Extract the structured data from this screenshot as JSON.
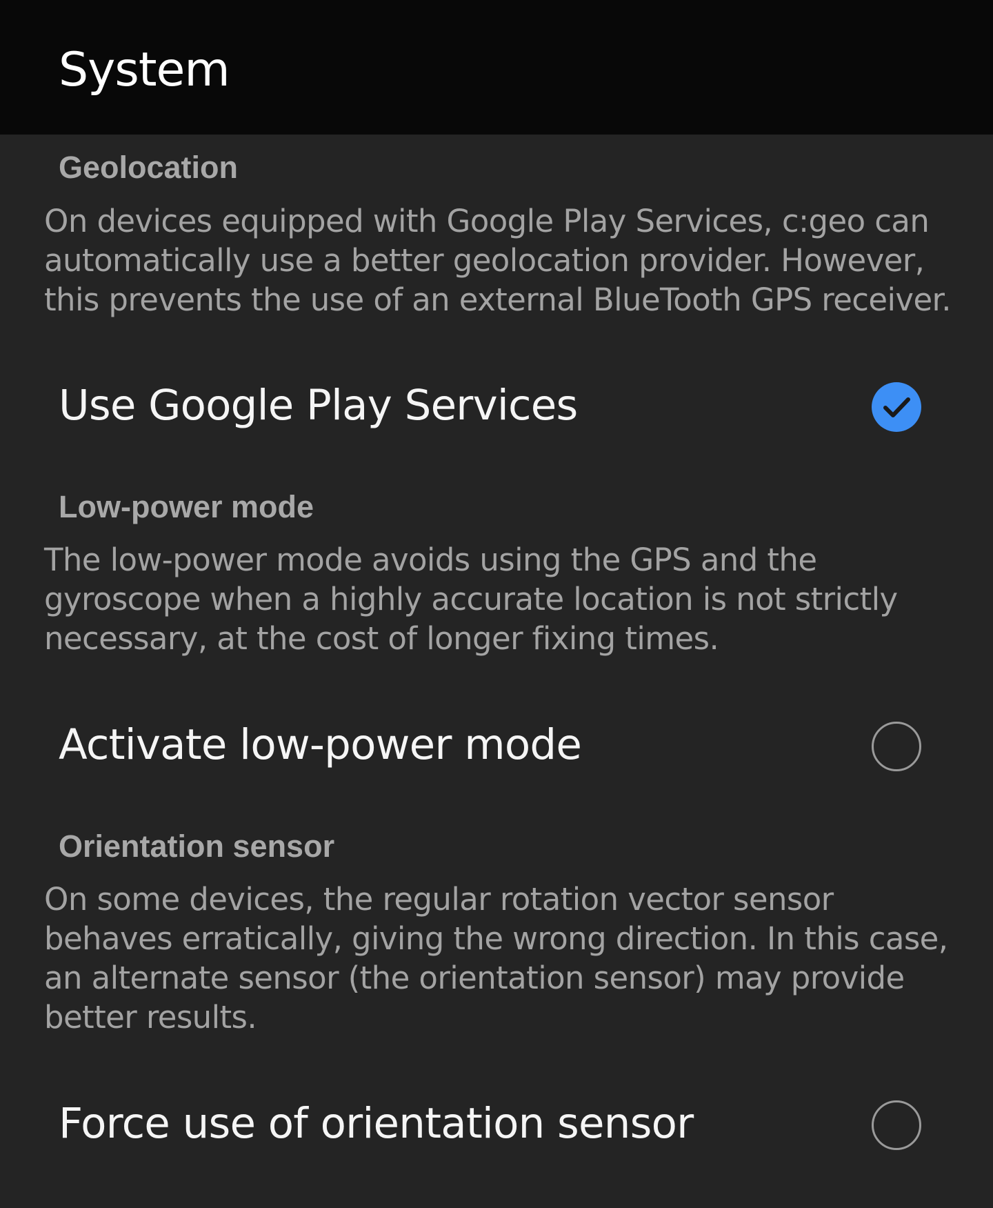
{
  "app_bar": {
    "title": "System"
  },
  "sections": [
    {
      "title": "Geolocation",
      "description": "On devices equipped with Google Play Services, c:geo can automatically use a better geolocation provider. However, this prevents the use of an external BlueTooth GPS receiver.",
      "option": {
        "label": "Use Google Play Services",
        "checked": true
      }
    },
    {
      "title": "Low-power mode",
      "description": "The low-power mode avoids using the GPS and the gyroscope when a highly accurate location is not strictly necessary, at the cost of longer fixing times.",
      "option": {
        "label": "Activate low-power mode",
        "checked": false
      }
    },
    {
      "title": "Orientation sensor",
      "description": "On some devices, the regular rotation vector sensor behaves erratically, giving the wrong direction. In this case, an alternate sensor (the orientation sensor) may provide better results.",
      "option": {
        "label": "Force use of orientation sensor",
        "checked": false
      }
    }
  ],
  "colors": {
    "app_bar_bg": "#080808",
    "content_bg": "#242424",
    "accent": "#3d8ff5",
    "check_mark": "#1a1a1a",
    "section_title": "#a8a8a8",
    "description": "#a3a3a3",
    "label": "#f5f5f5"
  },
  "icons": {
    "checked": "check-circle-filled-icon",
    "unchecked": "circle-outline-icon"
  }
}
